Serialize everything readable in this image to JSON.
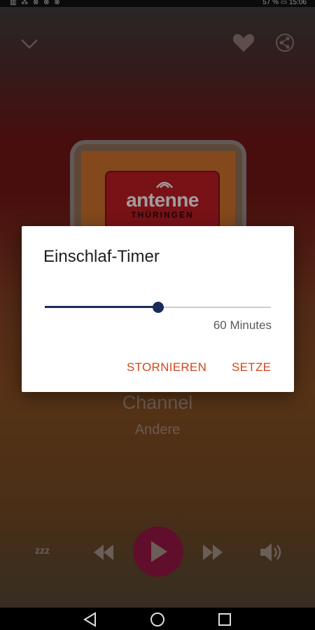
{
  "status_bar": {
    "left_indicators": "▥ ⁂ ⊗ ⊗ ⊗",
    "right_text": "57 % ▭ 15:06"
  },
  "player": {
    "channel_title": "Channel",
    "channel_subtitle": "Andere",
    "artwork": {
      "logo_text": "antenne",
      "logo_subtext": "THÜRINGEN"
    },
    "sleep_icon_text": "zzz"
  },
  "dialog": {
    "title": "Einschlaf-Timer",
    "slider_fraction": 0.5,
    "slider_value_text": "60 Minutes",
    "cancel_label": "STORNIEREN",
    "set_label": "SETZE"
  },
  "colors": {
    "accent": "#d2461c",
    "slider": "#1a2d59",
    "play_button": "#8e1640"
  },
  "icons": [
    "chevron-down-icon",
    "heart-icon",
    "share-icon",
    "sleep-timer-icon",
    "rewind-icon",
    "play-icon",
    "fast-forward-icon",
    "volume-icon",
    "nav-back-icon",
    "nav-home-icon",
    "nav-recent-icon"
  ]
}
